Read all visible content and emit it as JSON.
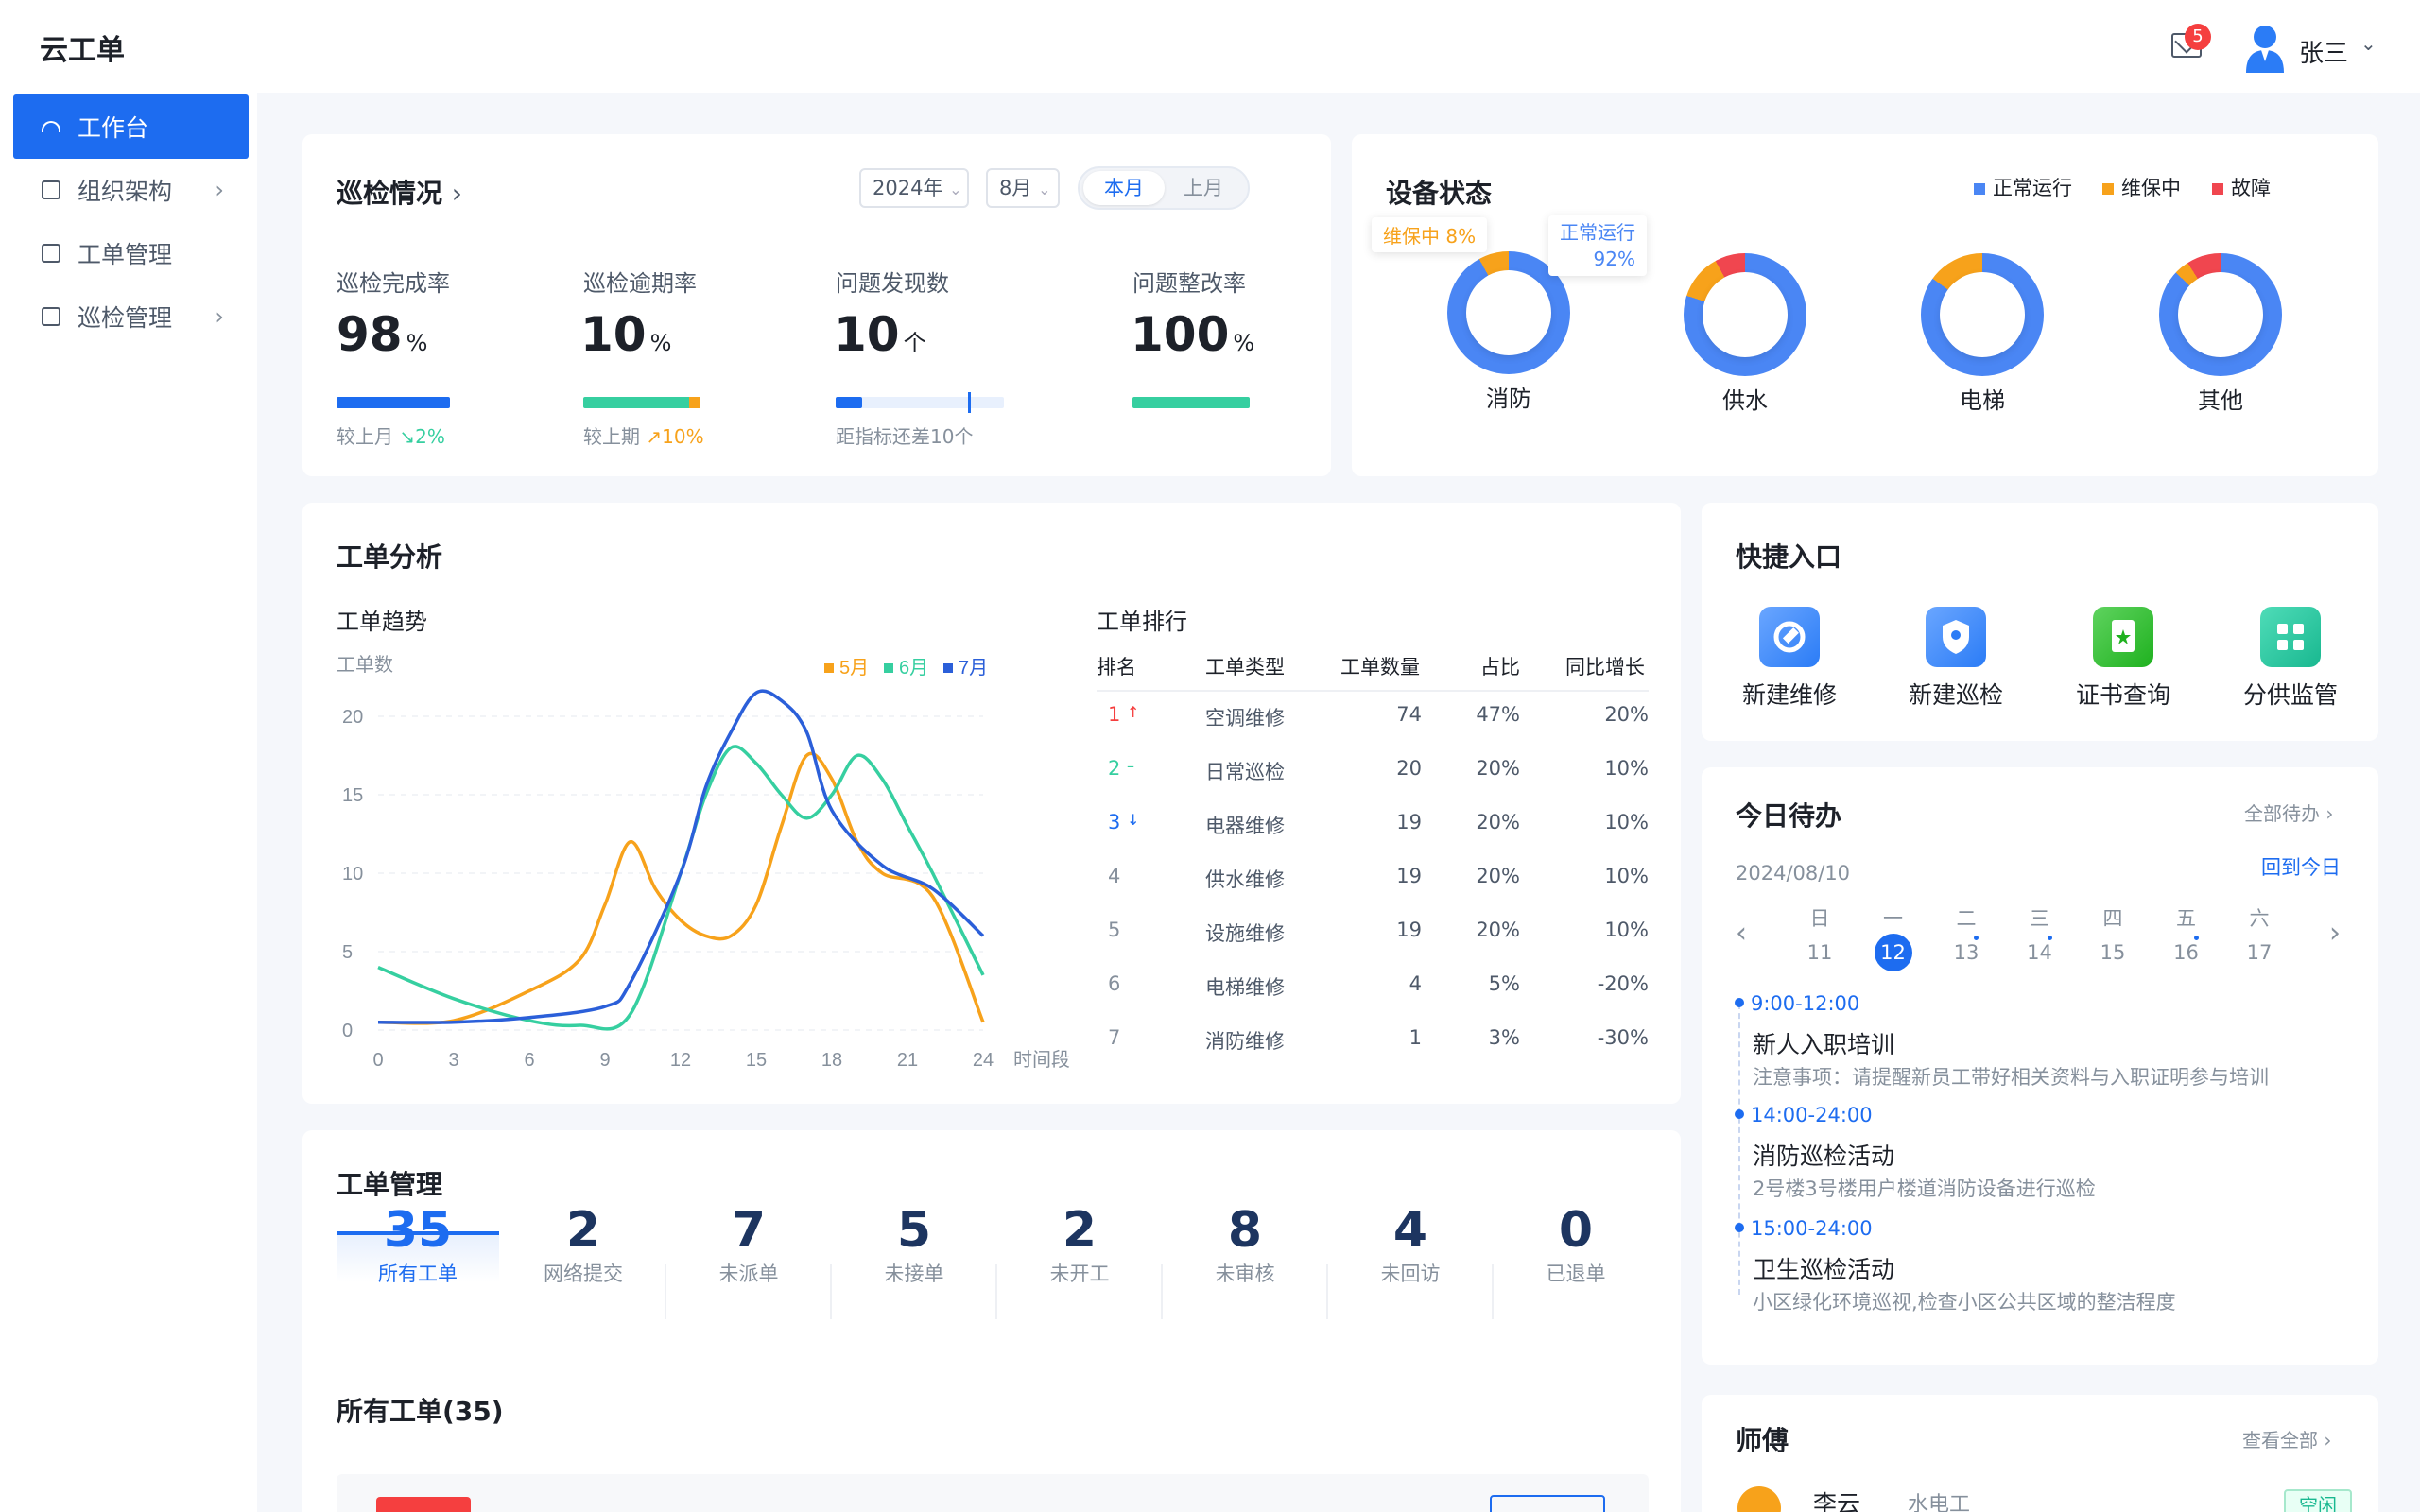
{
  "app": {
    "title": "云工单"
  },
  "header": {
    "mail_count": "5",
    "user_name": "张三"
  },
  "sidebar": {
    "items": [
      {
        "label": "工作台"
      },
      {
        "label": "组织架构"
      },
      {
        "label": "工单管理"
      },
      {
        "label": "巡检管理"
      }
    ]
  },
  "inspection": {
    "title": "巡检情况",
    "year": "2024年",
    "month": "8月",
    "seg_current": "本月",
    "seg_last": "上月",
    "kpis": [
      {
        "label": "巡检完成率",
        "value": "98",
        "unit": "%",
        "note": "较上月",
        "delta": "2%",
        "progress": 0.98
      },
      {
        "label": "巡检逾期率",
        "value": "10",
        "unit": "%",
        "note": "较上期",
        "delta": "10%",
        "progress": 0.1
      },
      {
        "label": "问题发现数",
        "value": "10",
        "unit": "个",
        "note": "距指标还差10个",
        "progress": 0.15
      },
      {
        "label": "问题整改率",
        "value": "100",
        "unit": "%",
        "progress": 1.0
      }
    ]
  },
  "devices": {
    "title": "设备状态",
    "legend": [
      "正常运行",
      "维保中",
      "故障"
    ],
    "colors": {
      "normal": "#4a86f4",
      "maint": "#f7a21b",
      "fault": "#f0464f"
    },
    "tip_maint": "维保中  8%",
    "tip_normal_label": "正常运行",
    "tip_normal_value": "92%",
    "items": [
      {
        "name": "消防",
        "normal": 0.92,
        "maint": 0.08,
        "fault": 0
      },
      {
        "name": "供水",
        "normal": 0.8,
        "maint": 0.12,
        "fault": 0.08
      },
      {
        "name": "电梯",
        "normal": 0.85,
        "maint": 0.15,
        "fault": 0
      },
      {
        "name": "其他",
        "normal": 0.87,
        "maint": 0.04,
        "fault": 0.09
      }
    ]
  },
  "analysis": {
    "title": "工单分析",
    "trend_title": "工单趋势",
    "rank_title": "工单排行",
    "rank_headers": [
      "排名",
      "工单类型",
      "工单数量",
      "占比",
      "同比增长"
    ],
    "rank_rows": [
      {
        "rank": "1",
        "type": "空调维修",
        "count": "74",
        "ratio": "47%",
        "yoy": "20%",
        "trend": "↑"
      },
      {
        "rank": "2",
        "type": "日常巡检",
        "count": "20",
        "ratio": "20%",
        "yoy": "10%",
        "trend": "–"
      },
      {
        "rank": "3",
        "type": "电器维修",
        "count": "19",
        "ratio": "20%",
        "yoy": "10%",
        "trend": "↓"
      },
      {
        "rank": "4",
        "type": "供水维修",
        "count": "19",
        "ratio": "20%",
        "yoy": "10%",
        "trend": ""
      },
      {
        "rank": "5",
        "type": "设施维修",
        "count": "19",
        "ratio": "20%",
        "yoy": "10%",
        "trend": ""
      },
      {
        "rank": "6",
        "type": "电梯维修",
        "count": "4",
        "ratio": "5%",
        "yoy": "-20%",
        "trend": ""
      },
      {
        "rank": "7",
        "type": "消防维修",
        "count": "1",
        "ratio": "3%",
        "yoy": "-30%",
        "trend": ""
      }
    ]
  },
  "chart_data": {
    "type": "line",
    "ylabel": "工单数",
    "xlabel": "时间段",
    "ylim": [
      0,
      20
    ],
    "xlim": [
      0,
      24
    ],
    "xticks": [
      "0",
      "3",
      "6",
      "9",
      "12",
      "15",
      "18",
      "21",
      "24"
    ],
    "yticks": [
      "0",
      "5",
      "10",
      "15",
      "20"
    ],
    "legend_position": "top-right",
    "series": [
      {
        "name": "5月",
        "color": "#f7a21b",
        "x": [
          0,
          3,
          6,
          8,
          9,
          10,
          11,
          12,
          13,
          14,
          15,
          16,
          17,
          18,
          19,
          20,
          22,
          24
        ],
        "y": [
          0.5,
          0.6,
          2.5,
          4.5,
          8,
          12,
          9,
          7,
          6,
          6,
          8,
          13,
          17.5,
          16,
          12,
          10,
          8.5,
          0.5
        ]
      },
      {
        "name": "6月",
        "color": "#36cfa0",
        "x": [
          0,
          3,
          6,
          8,
          10,
          12,
          13,
          14,
          15,
          16,
          17,
          18,
          19,
          20,
          21,
          22,
          24
        ],
        "y": [
          4,
          2,
          0.6,
          0.3,
          1,
          10,
          15,
          18,
          17,
          15,
          13.5,
          15,
          17.5,
          16,
          13,
          10,
          3.5
        ]
      },
      {
        "name": "7月",
        "color": "#2b5fd9",
        "x": [
          0,
          3,
          6,
          9,
          10,
          12,
          13,
          14,
          15,
          16,
          17,
          18,
          20,
          22,
          24
        ],
        "y": [
          0.5,
          0.5,
          0.8,
          1.5,
          3,
          10,
          15.5,
          19,
          21.5,
          21,
          19,
          14,
          10.5,
          9,
          6
        ]
      }
    ]
  },
  "quick": {
    "title": "快捷入口",
    "items": [
      {
        "label": "新建维修"
      },
      {
        "label": "新建巡检"
      },
      {
        "label": "证书查询"
      },
      {
        "label": "分供监管"
      }
    ]
  },
  "todo": {
    "title": "今日待办",
    "all_link": "全部待办",
    "date": "2024/08/10",
    "back_today": "回到今日",
    "week": [
      {
        "w": "日",
        "d": "11"
      },
      {
        "w": "一",
        "d": "12"
      },
      {
        "w": "二",
        "d": "13"
      },
      {
        "w": "三",
        "d": "14"
      },
      {
        "w": "四",
        "d": "15"
      },
      {
        "w": "五",
        "d": "16"
      },
      {
        "w": "六",
        "d": "17"
      }
    ],
    "events": [
      {
        "time": "9:00-12:00",
        "name": "新人入职培训",
        "desc": "注意事项：请提醒新员工带好相关资料与入职证明参与培训"
      },
      {
        "time": "14:00-24:00",
        "name": "消防巡检活动",
        "desc": "2号楼3号楼用户楼道消防设备进行巡检"
      },
      {
        "time": "15:00-24:00",
        "name": "卫生巡检活动",
        "desc": "小区绿化环境巡视,检查小区公共区域的整洁程度"
      }
    ]
  },
  "orders": {
    "title": "工单管理",
    "list_title": "所有工单(35)",
    "tabs": [
      {
        "n": "35",
        "l": "所有工单"
      },
      {
        "n": "2",
        "l": "网络提交"
      },
      {
        "n": "7",
        "l": "未派单"
      },
      {
        "n": "5",
        "l": "未接单"
      },
      {
        "n": "2",
        "l": "未开工"
      },
      {
        "n": "8",
        "l": "未审核"
      },
      {
        "n": "4",
        "l": "未回访"
      },
      {
        "n": "0",
        "l": "已退单"
      }
    ]
  },
  "masters": {
    "title": "师傅",
    "all_link": "查看全部",
    "name": "李云",
    "role": "水电工",
    "status": "空闲"
  }
}
